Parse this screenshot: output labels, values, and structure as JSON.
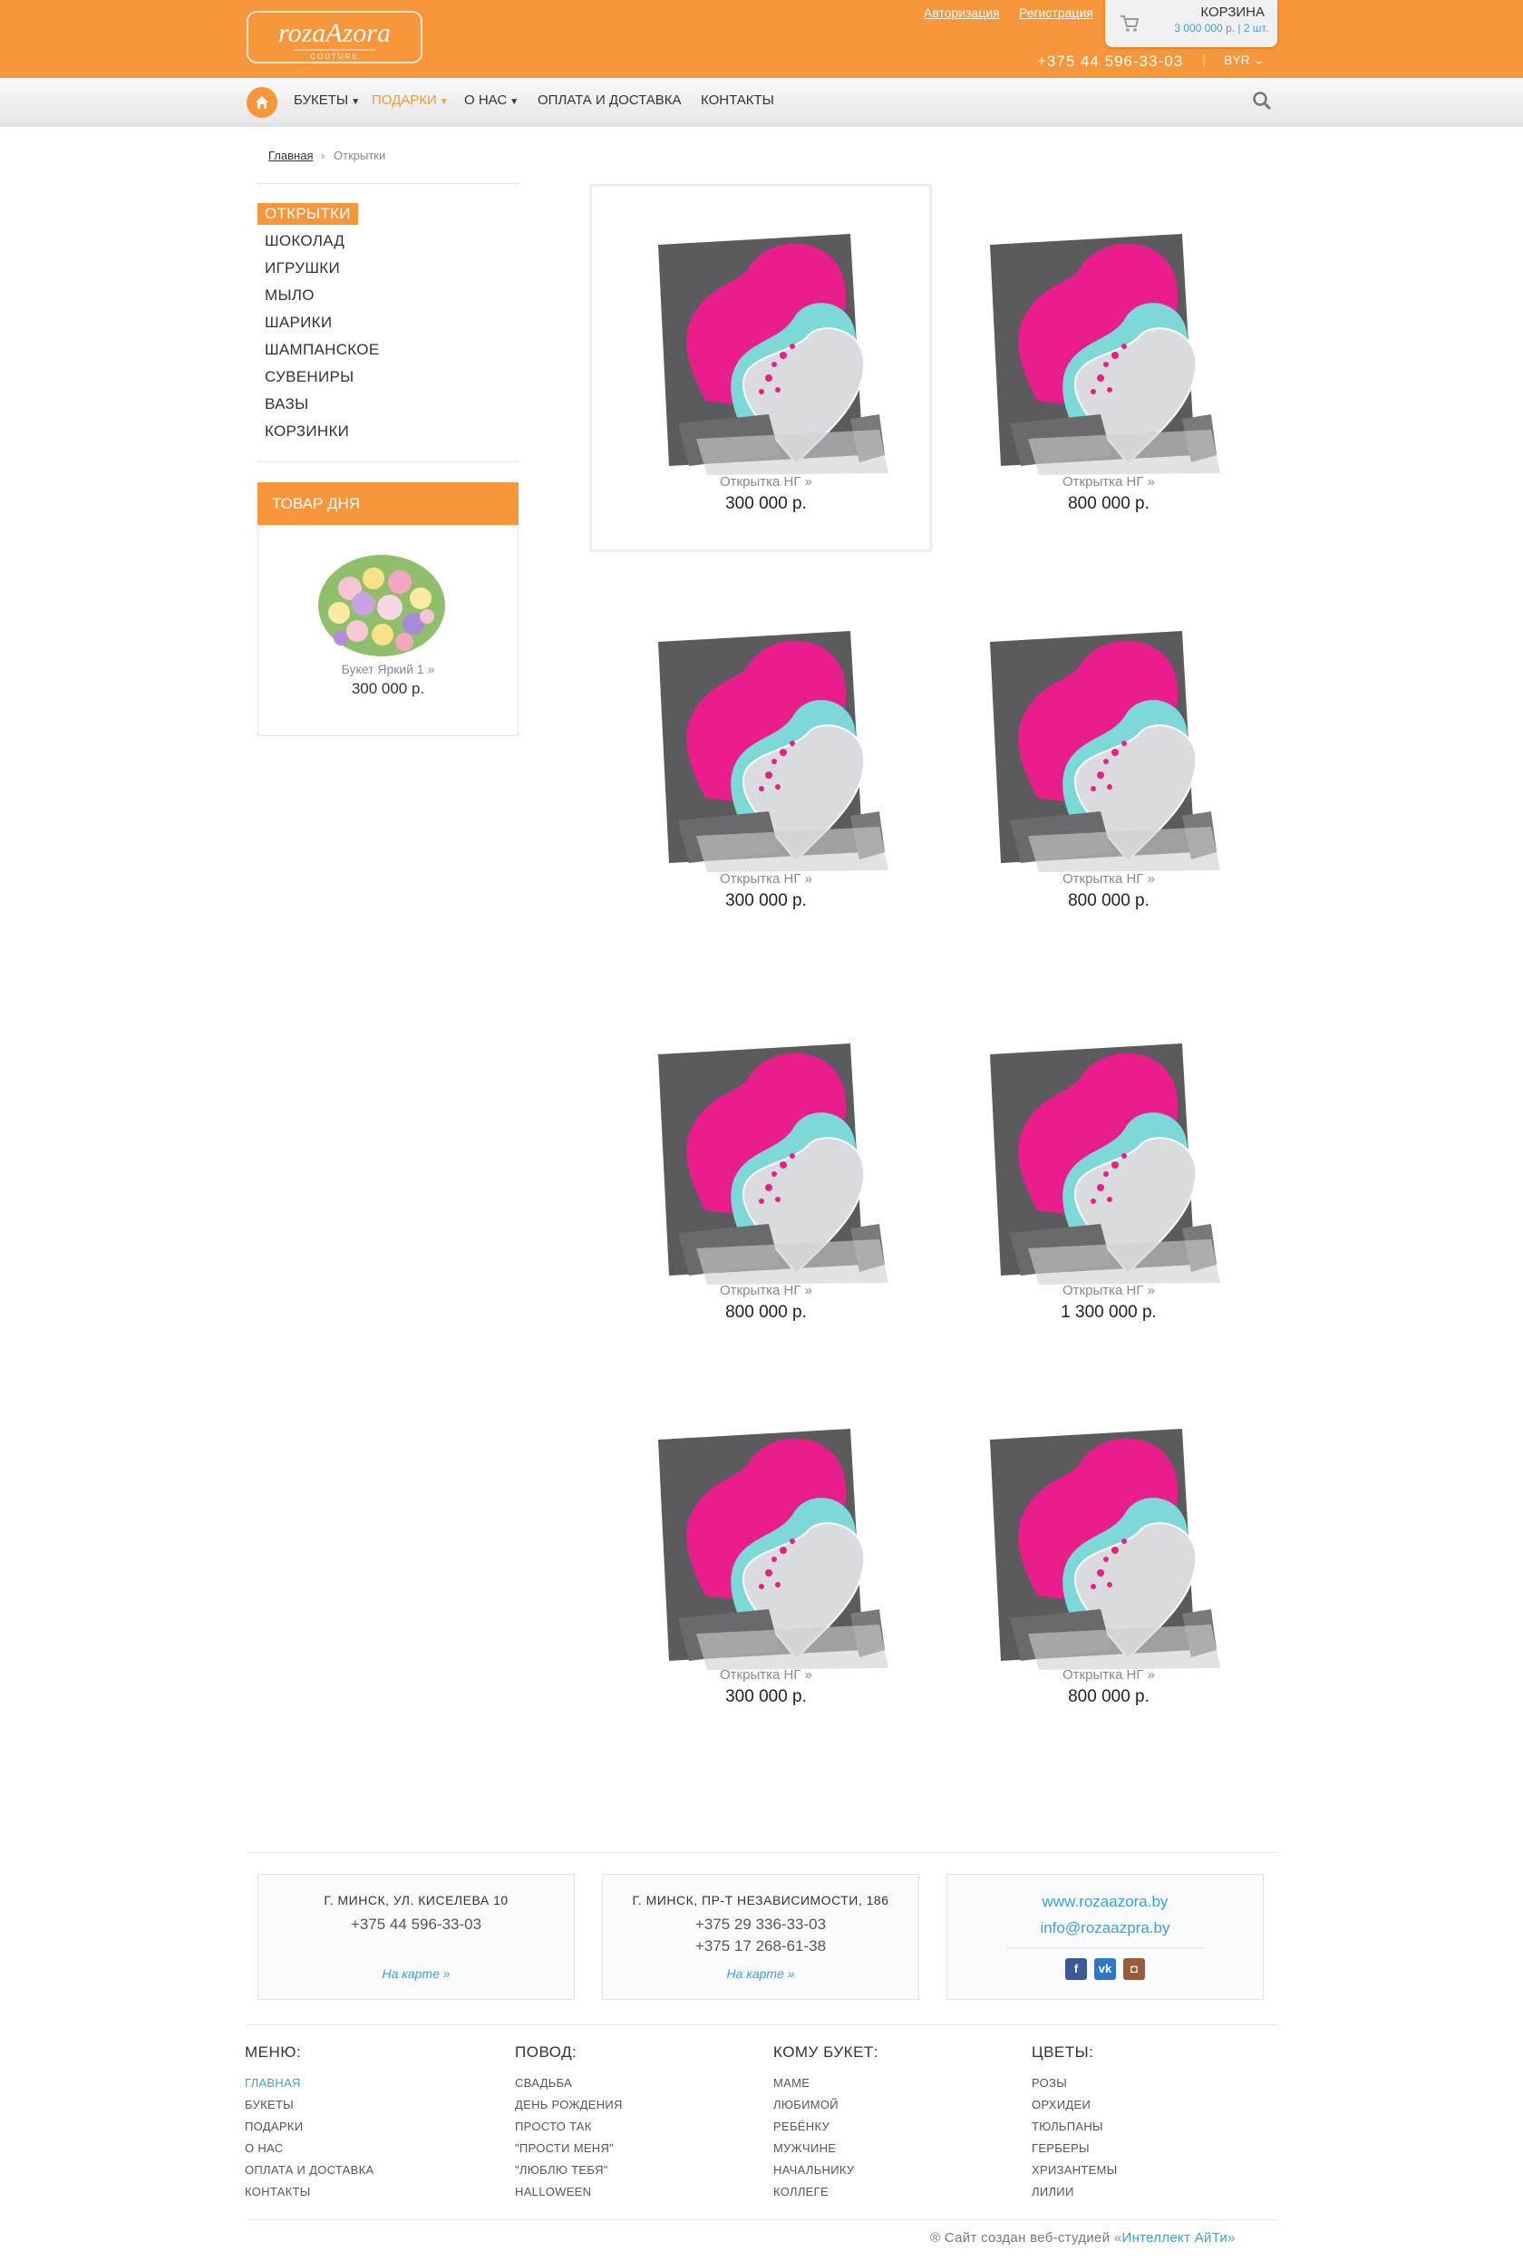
{
  "header": {
    "logo_text": "rozaAzora",
    "logo_sub": "COUTURE",
    "login": "Авторизация",
    "register": "Регистрация",
    "phone": "+375 44 596-33-03",
    "currency": "BYR",
    "cart": {
      "title": "КОРЗИНА",
      "info": "3 000 000 р. | 2 шт."
    }
  },
  "nav": {
    "items": [
      {
        "label": "БУКЕТЫ"
      },
      {
        "label": "ПОДАРКИ"
      },
      {
        "label": "О НАС"
      },
      {
        "label": "ОПЛАТА И ДОСТАВКА"
      },
      {
        "label": "КОНТАКТЫ"
      }
    ]
  },
  "breadcrumb": {
    "home": "Главная",
    "current": "Открытки"
  },
  "sidebar": {
    "items": [
      "ОТКРЫТКИ",
      "ШОКОЛАД",
      "ИГРУШКИ",
      "МЫЛО",
      "ШАРИКИ",
      "ШАМПАНСКОЕ",
      "СУВЕНИРЫ",
      "ВАЗЫ",
      "КОРЗИНКИ"
    ],
    "product_of_day": {
      "title": "ТОВАР ДНЯ",
      "name": "Букет Яркий 1 »",
      "price": "300 000 р."
    }
  },
  "products": [
    {
      "name": "Открытка НГ »",
      "price": "300 000 р."
    },
    {
      "name": "Открытка НГ »",
      "price": "800 000 р."
    },
    {
      "name": "Открытка НГ »",
      "price": "300 000 р."
    },
    {
      "name": "Открытка НГ »",
      "price": "800 000 р."
    },
    {
      "name": "Открытка НГ »",
      "price": "800 000 р."
    },
    {
      "name": "Открытка НГ »",
      "price": "1 300 000 р."
    },
    {
      "name": "Открытка НГ »",
      "price": "300 000 р."
    },
    {
      "name": "Открытка НГ »",
      "price": "800 000 р."
    }
  ],
  "footer": {
    "addresses": [
      {
        "title": "Г. МИНСК, УЛ. КИСЕЛЕВА 10",
        "phones": [
          "+375 44 596-33-03"
        ],
        "map": "На карте »"
      },
      {
        "title": "Г. МИНСК, ПР-Т НЕЗАВИСИМОСТИ, 186",
        "phones": [
          "+375 29 336-33-03",
          "+375 17 268-61-38"
        ],
        "map": "На карте »"
      }
    ],
    "site": "www.rozaazora.by",
    "email": "info@rozaazpra.by",
    "social": [
      "facebook-icon",
      "vk-icon",
      "instagram-icon"
    ],
    "columns": [
      {
        "title": "МЕНЮ:",
        "items": [
          "ГЛАВНАЯ",
          "БУКЕТЫ",
          "ПОДАРКИ",
          "О НАС",
          "ОПЛАТА И ДОСТАВКА",
          "КОНТАКТЫ"
        ]
      },
      {
        "title": "ПОВОД:",
        "items": [
          "СВАДЬБА",
          "ДЕНЬ РОЖДЕНИЯ",
          "ПРОСТО ТАК",
          "\"ПРОСТИ МЕНЯ\"",
          "\"ЛЮБЛЮ ТЕБЯ\"",
          "HALLOWEEN"
        ]
      },
      {
        "title": "КОМУ БУКЕТ:",
        "items": [
          "МАМЕ",
          "ЛЮБИМОЙ",
          "РЕБЁНКУ",
          "МУЖЧИНЕ",
          "НАЧАЛЬНИКУ",
          "КОЛЛЕГЕ"
        ]
      },
      {
        "title": "ЦВЕТЫ:",
        "items": [
          "РОЗЫ",
          "ОРХИДЕИ",
          "ТЮЛЬПАНЫ",
          "ГЕРБЕРЫ",
          "ХРИЗАНТЕМЫ",
          "ЛИЛИИ"
        ]
      }
    ],
    "copyright_prefix": "® Сайт создан веб-студией",
    "copyright_studio": "«Интеллект АйТи»"
  },
  "colors": {
    "accent": "#f7963a",
    "link": "#3aa1d8"
  }
}
